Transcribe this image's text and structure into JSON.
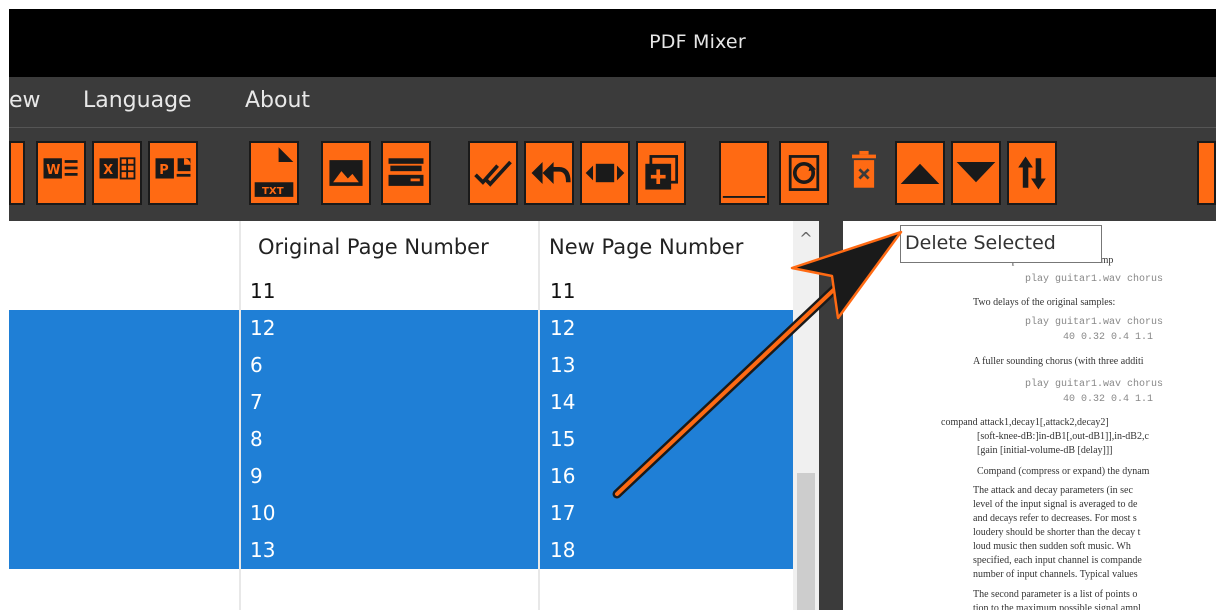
{
  "window": {
    "title": "PDF Mixer"
  },
  "menu": {
    "items": [
      "ew",
      "Language",
      "About"
    ]
  },
  "toolbar": {
    "buttons": [
      {
        "icon": "word-icon"
      },
      {
        "icon": "excel-icon"
      },
      {
        "icon": "powerpoint-icon"
      },
      {
        "icon": "txt-icon",
        "label": "TXT"
      },
      {
        "icon": "image-icon"
      },
      {
        "icon": "scanner-icon"
      },
      {
        "icon": "check-all-icon"
      },
      {
        "icon": "reply-all-icon"
      },
      {
        "icon": "resize-icon"
      },
      {
        "icon": "add-page-icon"
      },
      {
        "icon": "blank-page-icon"
      },
      {
        "icon": "rotate-icon"
      },
      {
        "icon": "delete-icon"
      },
      {
        "icon": "move-up-icon"
      },
      {
        "icon": "move-down-icon"
      },
      {
        "icon": "swap-icon"
      }
    ]
  },
  "table": {
    "columns": [
      "Original Page Number",
      "New Page Number"
    ],
    "rows": [
      {
        "original": "11",
        "new": "11",
        "selected": false
      },
      {
        "original": "12",
        "new": "12",
        "selected": true
      },
      {
        "original": "6",
        "new": "13",
        "selected": true
      },
      {
        "original": "7",
        "new": "14",
        "selected": true
      },
      {
        "original": "8",
        "new": "15",
        "selected": true
      },
      {
        "original": "9",
        "new": "16",
        "selected": true
      },
      {
        "original": "10",
        "new": "17",
        "selected": true
      },
      {
        "original": "13",
        "new": "18",
        "selected": true
      }
    ]
  },
  "tooltip": {
    "text": "Delete Selected"
  },
  "preview": {
    "lines": [
      {
        "text": "...uncompounded 2ms. For examp",
        "mono": false
      },
      {
        "text": "play guitar1.wav chorus",
        "mono": true
      },
      {
        "text": "Two delays of the original samples:",
        "mono": false
      },
      {
        "text": "play guitar1.wav chorus",
        "mono": true
      },
      {
        "text": "40 0.32 0.4 1.1",
        "mono": true
      },
      {
        "text": "A fuller sounding chorus (with three additi",
        "mono": false
      },
      {
        "text": "play guitar1.wav chorus",
        "mono": true
      },
      {
        "text": "40 0.32 0.4 1.1",
        "mono": true
      },
      {
        "text": "compand attack1,decay1[,attack2,decay2]",
        "mono": false
      },
      {
        "text": "[soft-knee-dB:]in-dB1[,out-dB1]],in-dB2,c",
        "mono": false
      },
      {
        "text": "[gain [initial-volume-dB [delay]]]",
        "mono": false
      },
      {
        "text": "Compand (compress or expand) the dynam",
        "mono": false
      },
      {
        "text": "The attack and decay parameters (in sec",
        "mono": false
      },
      {
        "text": "level of the input signal is averaged to de",
        "mono": false
      },
      {
        "text": "and decays refer to decreases. For most s",
        "mono": false
      },
      {
        "text": "loudery should be shorter than the decay t",
        "mono": false
      },
      {
        "text": "loud music then sudden soft music. Wh",
        "mono": false
      },
      {
        "text": "specified, each input channel is compande",
        "mono": false
      },
      {
        "text": "number of input channels. Typical values",
        "mono": false
      },
      {
        "text": "The second parameter is a list of points o",
        "mono": false
      },
      {
        "text": "tion to the maximum possible signal ampl",
        "mono": false
      }
    ]
  }
}
